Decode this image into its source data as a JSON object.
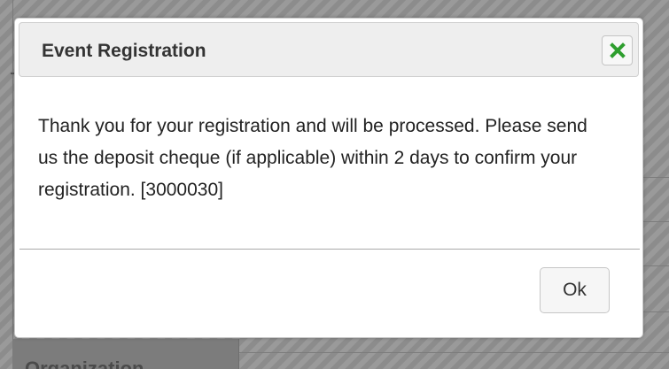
{
  "background": {
    "panel_label": "Organization"
  },
  "dialog": {
    "title": "Event Registration",
    "close_icon": "close-x-icon",
    "message": "Thank you for your registration and will be processed. Please send us the deposit cheque (if applicable) within 2 days to confirm your registration. [3000030]",
    "ok_label": "Ok"
  },
  "colors": {
    "close_icon_green": "#2e9e2e",
    "title_bar": "#eeeeee",
    "overlay": "#8c8c8c"
  }
}
